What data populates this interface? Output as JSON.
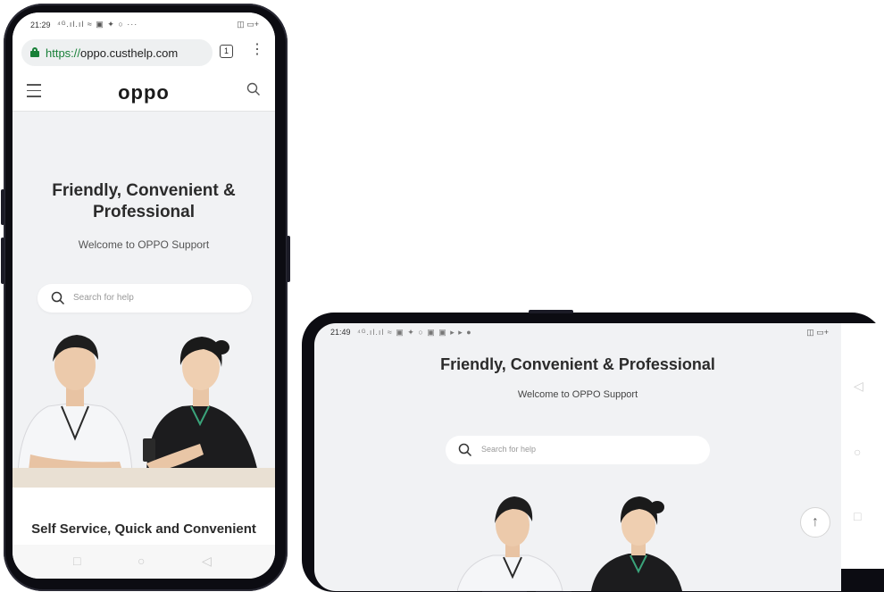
{
  "portrait": {
    "status": {
      "time": "21:29",
      "signal": "⁴ᴳ.ıl.ıl ≈ ▣ ✦ ○ ···",
      "battery": "◫ ▭+"
    },
    "browser": {
      "url_scheme": "https://",
      "url_host": "oppo.custhelp.com",
      "tab_count": "1",
      "menu_icon": "⋮"
    },
    "site": {
      "logo": "oppo"
    },
    "hero": {
      "title": "Friendly, Convenient & Professional",
      "subtitle": "Welcome to OPPO Support",
      "search_placeholder": "Search for help"
    },
    "section_title": "Self Service, Quick and Convenient",
    "nav": {
      "recent": "□",
      "home": "○",
      "back": "◁"
    }
  },
  "landscape": {
    "status": {
      "time": "21:49",
      "signal": "⁴ᴳ.ıl.ıl ≈ ▣ ✦ ○ ▣ ▣ ▸ ▸ ●",
      "battery": "◫ ▭+"
    },
    "hero": {
      "title": "Friendly, Convenient & Professional",
      "subtitle": "Welcome to OPPO Support",
      "search_placeholder": "Search for help"
    },
    "scroll_top_icon": "↑",
    "nav": {
      "back": "◁",
      "home": "○",
      "recent": "□"
    }
  },
  "colors": {
    "secure": "#188038",
    "hero_bg": "#f1f2f4",
    "shirt_black": "#1c1c1e",
    "shirt_white": "#f5f6f8"
  }
}
